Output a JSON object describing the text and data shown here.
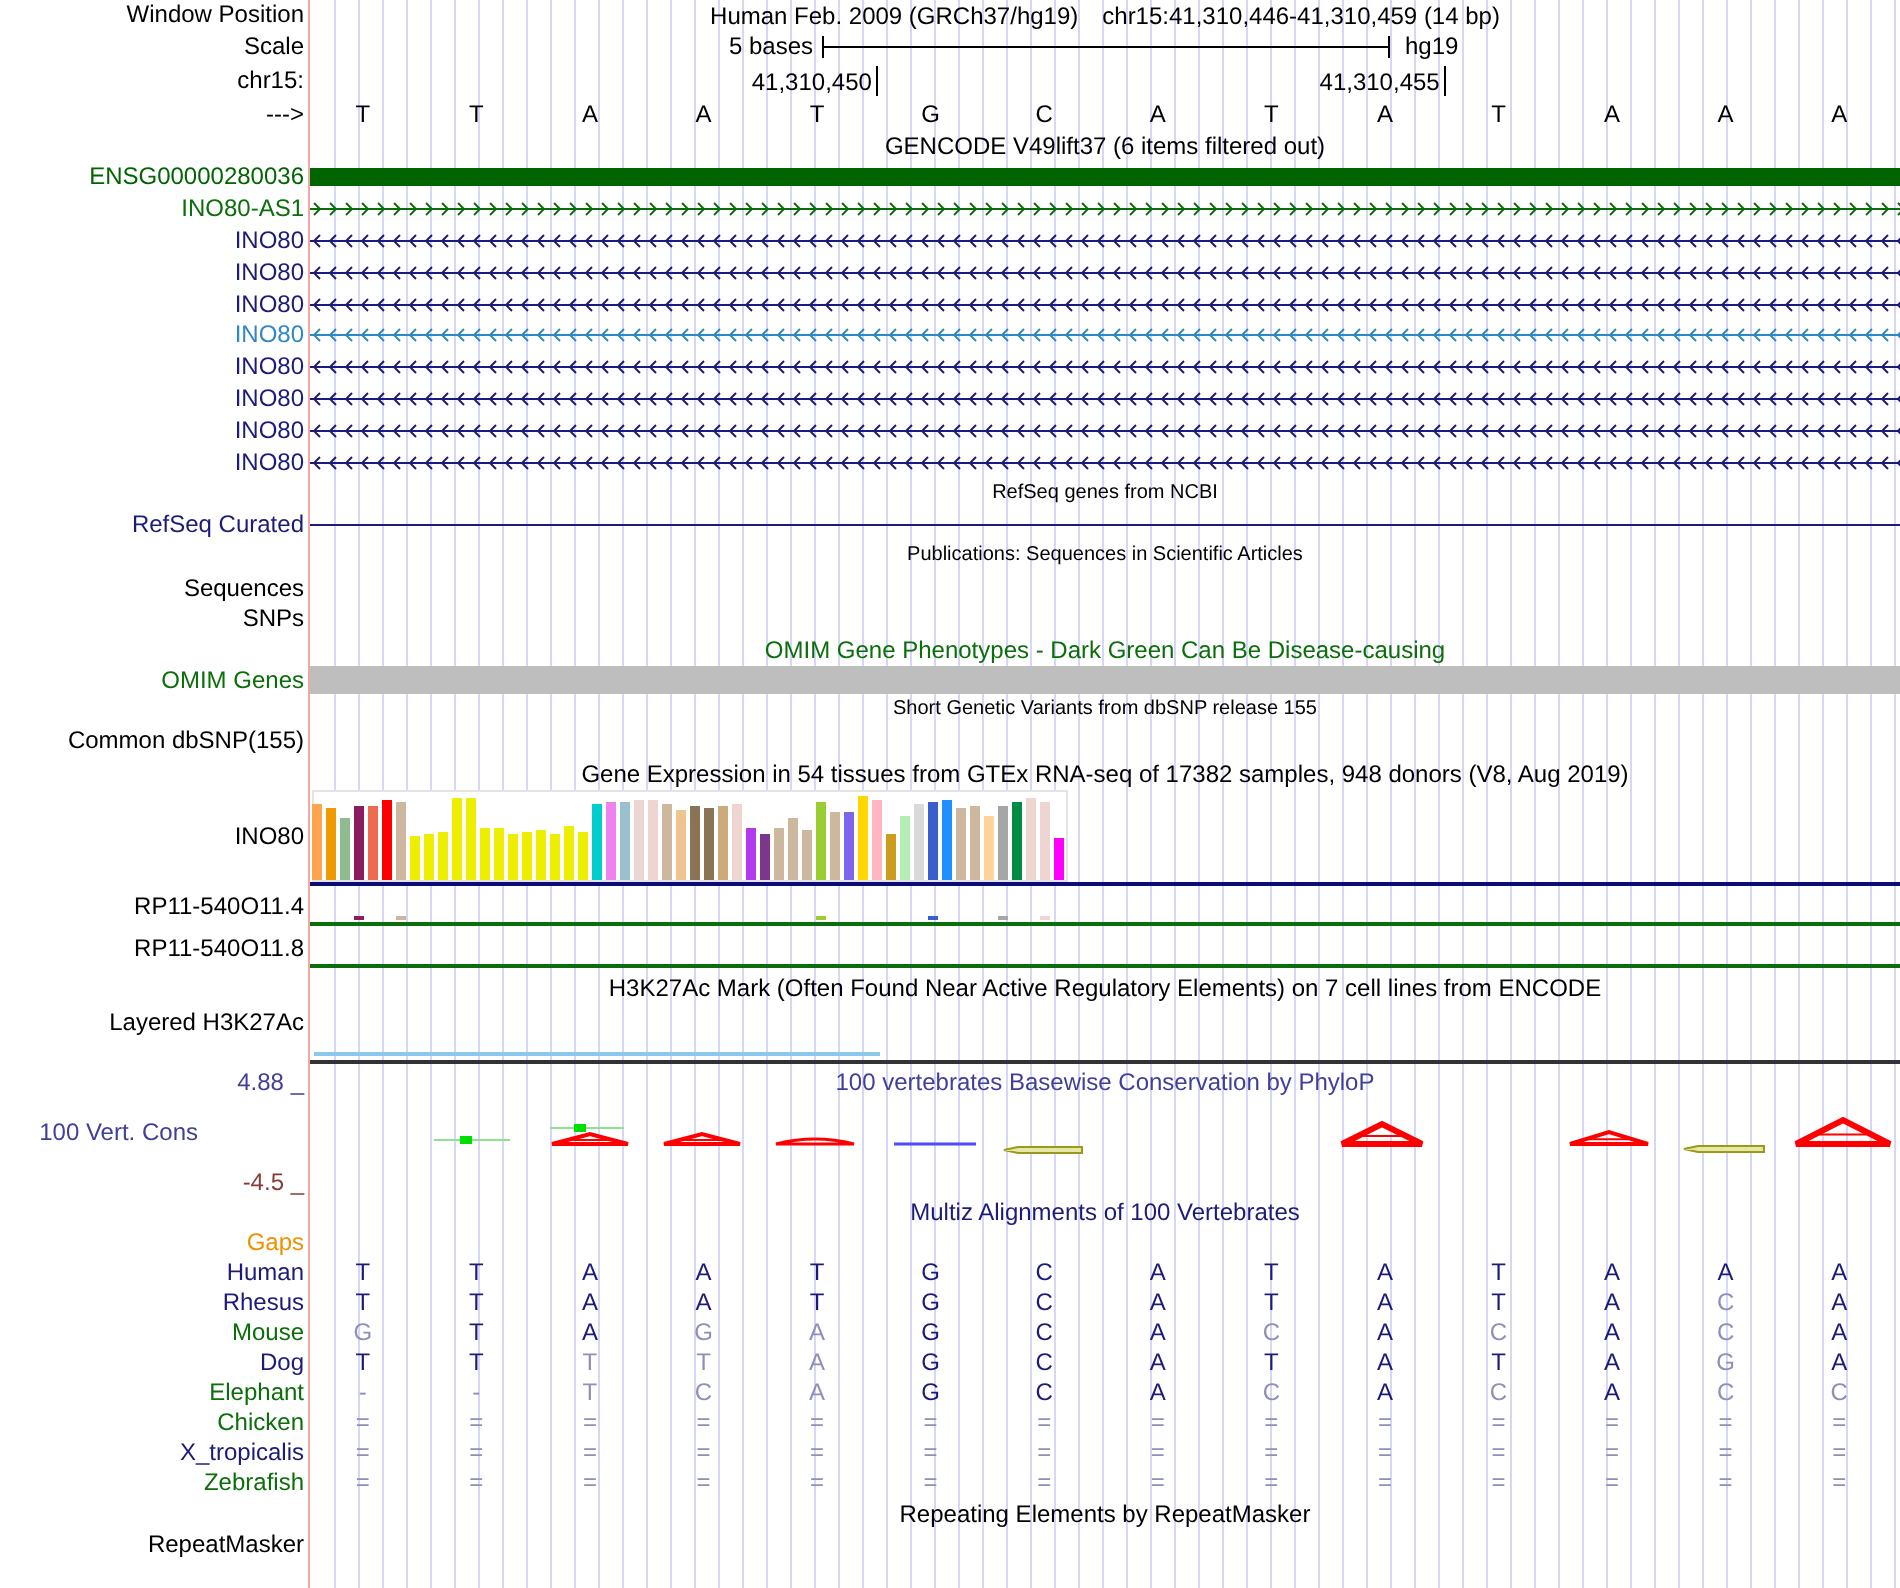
{
  "position": {
    "label": "Window Position",
    "assembly": "Human Feb. 2009 (GRCh37/hg19)",
    "range": "chr15:41,310,446-41,310,459 (14 bp)"
  },
  "scale": {
    "label": "Scale",
    "length": "5 bases",
    "assembly": "hg19"
  },
  "ruler": {
    "label": "chr15:",
    "ticks": [
      "41,310,450",
      "41,310,455"
    ]
  },
  "sequence": {
    "label": "--->",
    "bases": [
      "T",
      "T",
      "A",
      "A",
      "T",
      "G",
      "C",
      "A",
      "T",
      "A",
      "T",
      "A",
      "A",
      "A"
    ]
  },
  "tracks": [
    {
      "kind": "genes",
      "title": "GENCODE V49lift37 (6 items filtered out)",
      "color": "#000000",
      "items": [
        {
          "name": "ENSG00000280036",
          "kind": "block",
          "color": "#006400"
        },
        {
          "name": "INO80-AS1",
          "kind": "line",
          "reverse_strand": false,
          "color": "#0b6e0b"
        },
        {
          "name": "INO80",
          "kind": "line",
          "reverse_strand": true,
          "color": "#1c1c78"
        },
        {
          "name": "INO80",
          "kind": "line",
          "reverse_strand": true,
          "color": "#1c1c78"
        },
        {
          "name": "INO80",
          "kind": "line",
          "reverse_strand": true,
          "color": "#1c1c78"
        },
        {
          "name": "INO80",
          "kind": "line",
          "reverse_strand": true,
          "color": "#2f88c2"
        },
        {
          "name": "INO80",
          "kind": "line",
          "reverse_strand": true,
          "color": "#1c1c78"
        },
        {
          "name": "INO80",
          "kind": "line",
          "reverse_strand": true,
          "color": "#1c1c78"
        },
        {
          "name": "INO80",
          "kind": "line",
          "reverse_strand": true,
          "color": "#1c1c78"
        },
        {
          "name": "INO80",
          "kind": "line",
          "reverse_strand": true,
          "color": "#1c1c78"
        }
      ]
    },
    {
      "kind": "curated",
      "title": "RefSeq genes from NCBI",
      "color": "#000000",
      "items": [
        {
          "name": "RefSeq Curated",
          "color": "#1c1c78"
        }
      ]
    },
    {
      "kind": "articles",
      "title": "Publications: Sequences in Scientific Articles",
      "color": "#000000",
      "labels": [
        "Sequences",
        "SNPs"
      ]
    },
    {
      "kind": "phenotypes",
      "title": "OMIM Gene Phenotypes - Dark Green Can Be Disease-causing",
      "color": "#0b6e0b",
      "items": [
        {
          "name": "OMIM Genes",
          "color": "#bebebe"
        }
      ]
    },
    {
      "kind": "variants",
      "title": "Short Genetic Variants from dbSNP release 155",
      "color": "#000000",
      "labels": [
        "Common dbSNP(155)"
      ]
    },
    {
      "kind": "expression",
      "title": "Gene Expression in 54 tissues from GTEx RNA-seq of 17382 samples, 948 donors (V8, Aug 2019)",
      "color": "#000000",
      "items": [
        {
          "name": "INO80",
          "color": "#0c0c78"
        },
        {
          "name": "RP11-540O11.4",
          "color": "#0b6e0b"
        },
        {
          "name": "RP11-540O11.8",
          "color": "#0b6e0b"
        }
      ]
    },
    {
      "kind": "signal",
      "title": "H3K27Ac Mark (Often Found Near Active Regulatory Elements) on 7 cell lines from ENCODE",
      "color": "#000000",
      "labels": [
        "Layered H3K27Ac"
      ]
    },
    {
      "kind": "conservation",
      "title": "100 vertebrates Basewise Conservation by PhyloP",
      "color": "#40409a",
      "label": "100 Vert. Cons",
      "max": "4.88 _",
      "min": "-4.5 _"
    },
    {
      "kind": "alignment",
      "title": "Multiz Alignments of 100 Vertebrates",
      "color": "#1c1c78",
      "gaps": {
        "label": "Gaps",
        "color": "#ef9000"
      },
      "rows": [
        {
          "species": "Human",
          "color": "#1c1c78",
          "bases": [
            {
              "base": "T",
              "match": true
            },
            {
              "base": "T",
              "match": true
            },
            {
              "base": "A",
              "match": true
            },
            {
              "base": "A",
              "match": true
            },
            {
              "base": "T",
              "match": true
            },
            {
              "base": "G",
              "match": true
            },
            {
              "base": "C",
              "match": true
            },
            {
              "base": "A",
              "match": true
            },
            {
              "base": "T",
              "match": true
            },
            {
              "base": "A",
              "match": true
            },
            {
              "base": "T",
              "match": true
            },
            {
              "base": "A",
              "match": true
            },
            {
              "base": "A",
              "match": true
            },
            {
              "base": "A",
              "match": true
            }
          ]
        },
        {
          "species": "Rhesus",
          "color": "#1c1c78",
          "bases": [
            {
              "base": "T",
              "match": true
            },
            {
              "base": "T",
              "match": true
            },
            {
              "base": "A",
              "match": true
            },
            {
              "base": "A",
              "match": true
            },
            {
              "base": "T",
              "match": true
            },
            {
              "base": "G",
              "match": true
            },
            {
              "base": "C",
              "match": true
            },
            {
              "base": "A",
              "match": true
            },
            {
              "base": "T",
              "match": true
            },
            {
              "base": "A",
              "match": true
            },
            {
              "base": "T",
              "match": true
            },
            {
              "base": "A",
              "match": true
            },
            {
              "base": "C",
              "match": false
            },
            {
              "base": "A",
              "match": true
            }
          ]
        },
        {
          "species": "Mouse",
          "color": "#0b6e0b",
          "bases": [
            {
              "base": "G",
              "match": false
            },
            {
              "base": "T",
              "match": true
            },
            {
              "base": "A",
              "match": true
            },
            {
              "base": "G",
              "match": false
            },
            {
              "base": "A",
              "match": false
            },
            {
              "base": "G",
              "match": true
            },
            {
              "base": "C",
              "match": true
            },
            {
              "base": "A",
              "match": true
            },
            {
              "base": "C",
              "match": false
            },
            {
              "base": "A",
              "match": true
            },
            {
              "base": "C",
              "match": false
            },
            {
              "base": "A",
              "match": true
            },
            {
              "base": "C",
              "match": false
            },
            {
              "base": "A",
              "match": true
            }
          ]
        },
        {
          "species": "Dog",
          "color": "#1c1c78",
          "bases": [
            {
              "base": "T",
              "match": true
            },
            {
              "base": "T",
              "match": true
            },
            {
              "base": "T",
              "match": false
            },
            {
              "base": "T",
              "match": false
            },
            {
              "base": "A",
              "match": false
            },
            {
              "base": "G",
              "match": true
            },
            {
              "base": "C",
              "match": true
            },
            {
              "base": "A",
              "match": true
            },
            {
              "base": "T",
              "match": true
            },
            {
              "base": "A",
              "match": true
            },
            {
              "base": "T",
              "match": true
            },
            {
              "base": "A",
              "match": true
            },
            {
              "base": "G",
              "match": false
            },
            {
              "base": "A",
              "match": true
            }
          ]
        },
        {
          "species": "Elephant",
          "color": "#0b6e0b",
          "bases": [
            {
              "base": "-",
              "match": false
            },
            {
              "base": "-",
              "match": false
            },
            {
              "base": "T",
              "match": false
            },
            {
              "base": "C",
              "match": false
            },
            {
              "base": "A",
              "match": false
            },
            {
              "base": "G",
              "match": true
            },
            {
              "base": "C",
              "match": true
            },
            {
              "base": "A",
              "match": true
            },
            {
              "base": "C",
              "match": false
            },
            {
              "base": "A",
              "match": true
            },
            {
              "base": "C",
              "match": false
            },
            {
              "base": "A",
              "match": true
            },
            {
              "base": "C",
              "match": false
            },
            {
              "base": "C",
              "match": false
            }
          ]
        },
        {
          "species": "Chicken",
          "color": "#0b6e0b",
          "bases": [
            {
              "base": "=",
              "match": false
            },
            {
              "base": "=",
              "match": false
            },
            {
              "base": "=",
              "match": false
            },
            {
              "base": "=",
              "match": false
            },
            {
              "base": "=",
              "match": false
            },
            {
              "base": "=",
              "match": false
            },
            {
              "base": "=",
              "match": false
            },
            {
              "base": "=",
              "match": false
            },
            {
              "base": "=",
              "match": false
            },
            {
              "base": "=",
              "match": false
            },
            {
              "base": "=",
              "match": false
            },
            {
              "base": "=",
              "match": false
            },
            {
              "base": "=",
              "match": false
            },
            {
              "base": "=",
              "match": false
            }
          ]
        },
        {
          "species": "X_tropicalis",
          "color": "#1c1c78",
          "bases": [
            {
              "base": "=",
              "match": false
            },
            {
              "base": "=",
              "match": false
            },
            {
              "base": "=",
              "match": false
            },
            {
              "base": "=",
              "match": false
            },
            {
              "base": "=",
              "match": false
            },
            {
              "base": "=",
              "match": false
            },
            {
              "base": "=",
              "match": false
            },
            {
              "base": "=",
              "match": false
            },
            {
              "base": "=",
              "match": false
            },
            {
              "base": "=",
              "match": false
            },
            {
              "base": "=",
              "match": false
            },
            {
              "base": "=",
              "match": false
            },
            {
              "base": "=",
              "match": false
            },
            {
              "base": "=",
              "match": false
            }
          ]
        },
        {
          "species": "Zebrafish",
          "color": "#0b6e0b",
          "bases": [
            {
              "base": "=",
              "match": false
            },
            {
              "base": "=",
              "match": false
            },
            {
              "base": "=",
              "match": false
            },
            {
              "base": "=",
              "match": false
            },
            {
              "base": "=",
              "match": false
            },
            {
              "base": "=",
              "match": false
            },
            {
              "base": "=",
              "match": false
            },
            {
              "base": "=",
              "match": false
            },
            {
              "base": "=",
              "match": false
            },
            {
              "base": "=",
              "match": false
            },
            {
              "base": "=",
              "match": false
            },
            {
              "base": "=",
              "match": false
            },
            {
              "base": "=",
              "match": false
            },
            {
              "base": "=",
              "match": false
            }
          ]
        }
      ]
    },
    {
      "kind": "repeats",
      "title": "Repeating Elements by RepeatMasker",
      "color": "#000000",
      "labels": [
        "RepeatMasker"
      ]
    }
  ]
}
